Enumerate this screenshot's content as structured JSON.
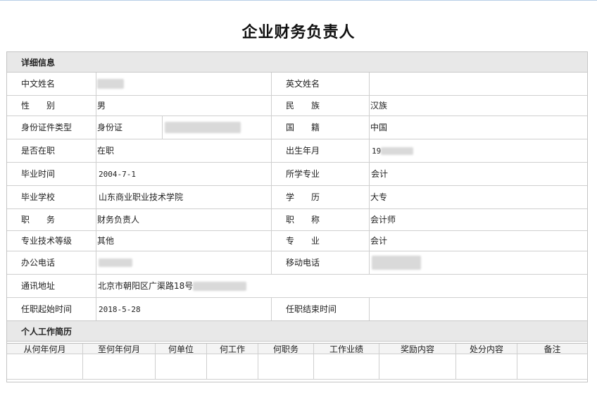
{
  "page": {
    "title": "企业财务负责人"
  },
  "details": {
    "section_title": "详细信息",
    "chinese_name": {
      "label": "中文姓名",
      "value": ""
    },
    "english_name": {
      "label": "英文姓名",
      "value": ""
    },
    "gender": {
      "label": "性　　别",
      "value": "男"
    },
    "ethnicity": {
      "label": "民　　族",
      "value": "汉族"
    },
    "id_type": {
      "label": "身份证件类型",
      "value": "身份证"
    },
    "nationality": {
      "label": "国　　籍",
      "value": "中国"
    },
    "employed": {
      "label": "是否在职",
      "value": "在职"
    },
    "birth": {
      "label": "出生年月",
      "value": "19"
    },
    "grad_time": {
      "label": "毕业时间",
      "value": "2004-7-1"
    },
    "major": {
      "label": "所学专业",
      "value": "会计"
    },
    "school": {
      "label": "毕业学校",
      "value": "山东商业职业技术学院"
    },
    "education": {
      "label": "学　　历",
      "value": "大专"
    },
    "position": {
      "label": "职　　务",
      "value": "财务负责人"
    },
    "title_rank": {
      "label": "职　　称",
      "value": "会计师"
    },
    "tech_level": {
      "label": "专业技术等级",
      "value": "其他"
    },
    "specialty": {
      "label": "专　　业",
      "value": "会计"
    },
    "office_phone": {
      "label": "办公电话"
    },
    "mobile_phone": {
      "label": "移动电话"
    },
    "address": {
      "label": "通讯地址",
      "value": "北京市朝阳区广渠路18号"
    },
    "start_time": {
      "label": "任职起始时间",
      "value": "2018-5-28"
    },
    "end_time": {
      "label": "任职结束时间",
      "value": ""
    }
  },
  "resume": {
    "section_title": "个人工作简历",
    "columns": [
      "从何年何月",
      "至何年何月",
      "何单位",
      "何工作",
      "何职务",
      "工作业绩",
      "奖励内容",
      "处分内容",
      "备注"
    ]
  }
}
